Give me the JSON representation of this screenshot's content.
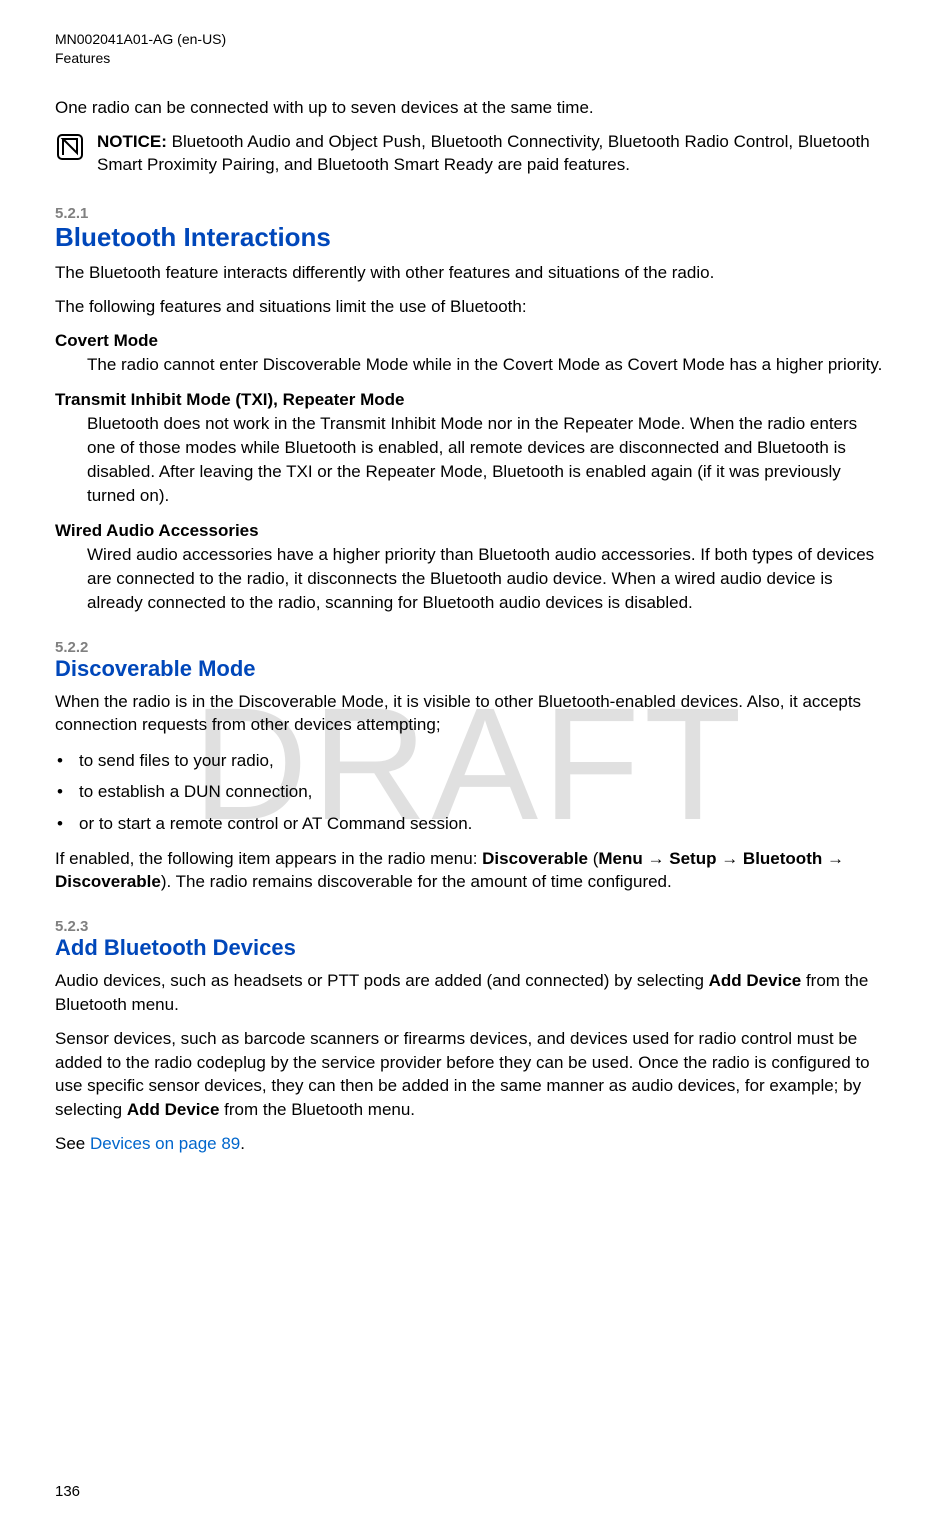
{
  "header": {
    "doc_id": "MN002041A01-AG (en-US)",
    "chapter": "Features"
  },
  "watermark": "DRAFT",
  "intro": "One radio can be connected with up to seven devices at the same time.",
  "notice": {
    "label": "NOTICE:",
    "text": " Bluetooth Audio and Object Push, Bluetooth Connectivity, Bluetooth Radio Control, Bluetooth Smart Proximity Pairing, and Bluetooth Smart Ready are paid features."
  },
  "sections": {
    "s521": {
      "num": "5.2.1",
      "title": "Bluetooth Interactions",
      "p1": "The Bluetooth feature interacts differently with other features and situations of the radio.",
      "p2": "The following features and situations limit the use of Bluetooth:",
      "terms": {
        "t1_label": "Covert Mode",
        "t1_def": "The radio cannot enter Discoverable Mode while in the Covert Mode as Covert Mode has a higher priority.",
        "t2_label": "Transmit Inhibit Mode (TXI), Repeater Mode",
        "t2_def": "Bluetooth does not work in the Transmit Inhibit Mode nor in the Repeater Mode. When the radio enters one of those modes while Bluetooth is enabled, all remote devices are disconnected and Bluetooth is disabled. After leaving the TXI or the Repeater Mode, Bluetooth is enabled again (if it was previously turned on).",
        "t3_label": "Wired Audio Accessories",
        "t3_def": "Wired audio accessories have a higher priority than Bluetooth audio accessories. If both types of devices are connected to the radio, it disconnects the Bluetooth audio device. When a wired audio device is already connected to the radio, scanning for Bluetooth audio devices is disabled."
      }
    },
    "s522": {
      "num": "5.2.2",
      "title": "Discoverable Mode",
      "p1": "When the radio is in the Discoverable Mode, it is visible to other Bluetooth-enabled devices. Also, it accepts connection requests from other devices attempting;",
      "bullets": {
        "b1": "to send files to your radio,",
        "b2": "to establish a DUN connection,",
        "b3": "or to start a remote control or AT Command session."
      },
      "p2_pre": "If enabled, the following item appears in the radio menu: ",
      "p2_bold1": "Discoverable",
      "p2_mid1": " (",
      "p2_bold2": "Menu",
      "p2_arrow1": " → ",
      "p2_bold3": "Setup",
      "p2_arrow2": " → ",
      "p2_bold4": "Bluetooth",
      "p2_arrow3": " → ",
      "p2_bold5": "Discoverable",
      "p2_post": "). The radio remains discoverable for the amount of time configured."
    },
    "s523": {
      "num": "5.2.3",
      "title": "Add Bluetooth Devices",
      "p1_pre": "Audio devices, such as headsets or PTT pods are added (and connected) by selecting ",
      "p1_bold": "Add Device",
      "p1_post": " from the Bluetooth menu.",
      "p2_pre": "Sensor devices, such as barcode scanners or firearms devices, and devices used for radio control must be added to the radio codeplug by the service provider before they can be used. Once the radio is configured to use specific sensor devices, they can then be added in the same manner as audio devices, for example; by selecting ",
      "p2_bold": "Add Device",
      "p2_post": " from the Bluetooth menu.",
      "p3_pre": "See ",
      "p3_link": "Devices on page 89",
      "p3_post": "."
    }
  },
  "page_number": "136"
}
